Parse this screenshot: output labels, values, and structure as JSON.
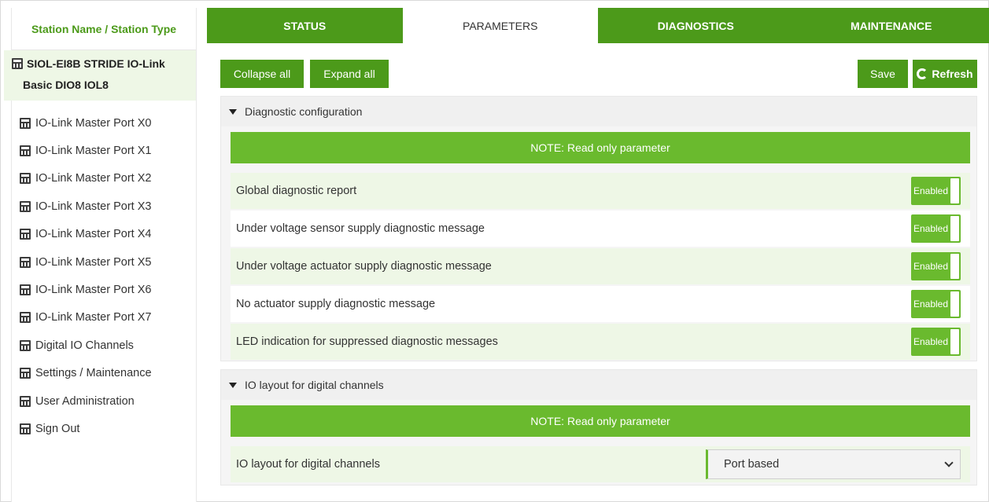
{
  "sidebar": {
    "title": "Station Name / Station Type",
    "station": {
      "line1": "SIOL-EI8B STRIDE IO-Link",
      "line2": "Basic DIO8 IOL8"
    },
    "items": [
      {
        "label": "IO-Link Master Port X0"
      },
      {
        "label": "IO-Link Master Port X1"
      },
      {
        "label": "IO-Link Master Port X2"
      },
      {
        "label": "IO-Link Master Port X3"
      },
      {
        "label": "IO-Link Master Port X4"
      },
      {
        "label": "IO-Link Master Port X5"
      },
      {
        "label": "IO-Link Master Port X6"
      },
      {
        "label": "IO-Link Master Port X7"
      },
      {
        "label": "Digital IO Channels"
      },
      {
        "label": "Settings / Maintenance"
      },
      {
        "label": "User Administration"
      },
      {
        "label": "Sign Out"
      }
    ]
  },
  "tabs": [
    {
      "label": "STATUS"
    },
    {
      "label": "PARAMETERS"
    },
    {
      "label": "DIAGNOSTICS"
    },
    {
      "label": "MAINTENANCE"
    }
  ],
  "active_tab": "PARAMETERS",
  "toolbar": {
    "collapse_label": "Collapse all",
    "expand_label": "Expand all",
    "save_label": "Save",
    "refresh_label": "Refresh"
  },
  "sections": {
    "diag": {
      "title": "Diagnostic configuration",
      "note": "NOTE: Read only parameter",
      "rows": [
        {
          "label": "Global diagnostic report",
          "value": "Enabled"
        },
        {
          "label": "Under voltage sensor supply diagnostic message",
          "value": "Enabled"
        },
        {
          "label": "Under voltage actuator supply diagnostic message",
          "value": "Enabled"
        },
        {
          "label": "No actuator supply diagnostic message",
          "value": "Enabled"
        },
        {
          "label": "LED indication for suppressed diagnostic messages",
          "value": "Enabled"
        }
      ]
    },
    "io": {
      "title": "IO layout for digital channels",
      "note": "NOTE: Read only parameter",
      "row": {
        "label": "IO layout for digital channels",
        "value": "Port based"
      }
    }
  },
  "colors": {
    "brand": "#4c9a1a",
    "accent": "#6aba2e",
    "row_tint": "#eef7e6"
  },
  "icons": {
    "device": "device-module-icon",
    "expand": "triangle-down-icon",
    "refresh": "refresh-icon",
    "select": "chevron-down-icon"
  }
}
